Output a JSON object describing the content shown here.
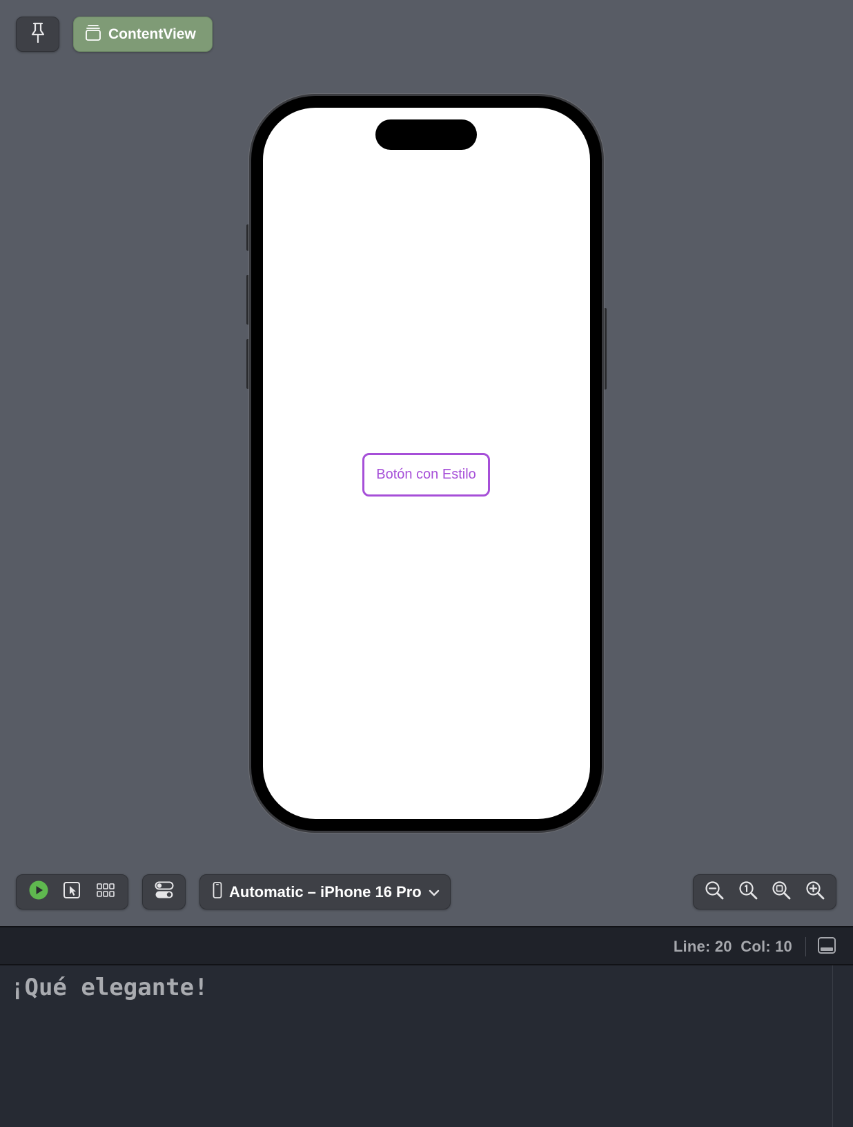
{
  "header": {
    "chip_label": "ContentView"
  },
  "preview": {
    "button_label": "Botón con Estilo"
  },
  "toolbar": {
    "device_label": "Automatic – iPhone 16 Pro"
  },
  "status": {
    "line_col": "Line: 20  Col: 10"
  },
  "console": {
    "text": "¡Qué elegante!"
  },
  "icons": {
    "pin": "pin-icon",
    "chip": "stack-icon",
    "play": "play-icon",
    "select": "cursor-select-icon",
    "variants": "grid-icon",
    "settings": "toggles-icon",
    "device": "iphone-icon",
    "chevron": "chevron-down-icon",
    "zoom_out": "zoom-out-icon",
    "zoom_actual": "zoom-actual-size-icon",
    "zoom_fit": "zoom-to-fit-icon",
    "zoom_in": "zoom-in-icon",
    "panel": "bottom-panel-icon"
  },
  "colors": {
    "canvas": "#585c65",
    "chip_bg": "#7f9b76",
    "button_accent": "#a64fd8",
    "play_green": "#5fb84f"
  }
}
